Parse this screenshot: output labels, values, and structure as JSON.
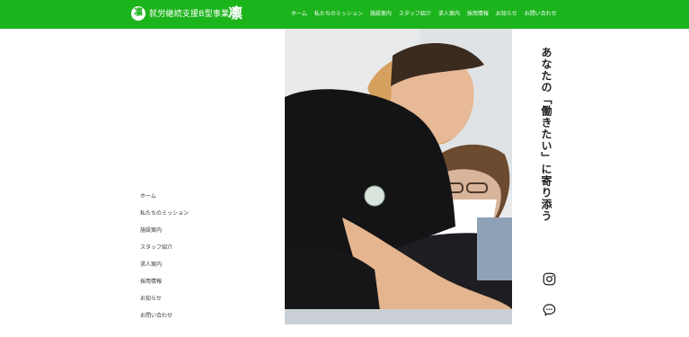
{
  "header": {
    "logo_glyph": "凛",
    "brand_text": "就労継続支援B型事業所",
    "brand_mark": "凛",
    "nav": [
      "ホーム",
      "私たちのミッション",
      "施設案内",
      "スタッフ紹介",
      "求人案内",
      "採用情報",
      "お知らせ",
      "お問い合わせ"
    ],
    "background": "#1cb41c"
  },
  "side_nav": [
    "ホーム",
    "私たちのミッション",
    "施設案内",
    "スタッフ紹介",
    "求人案内",
    "採用情報",
    "お知らせ",
    "お問い合わせ"
  ],
  "hero": {
    "alt": "Woman and man working together at a table"
  },
  "catchphrase": "あなたの「働きたい」に寄り添う",
  "icons": {
    "instagram": "instagram-icon",
    "chat": "chat-icon"
  }
}
